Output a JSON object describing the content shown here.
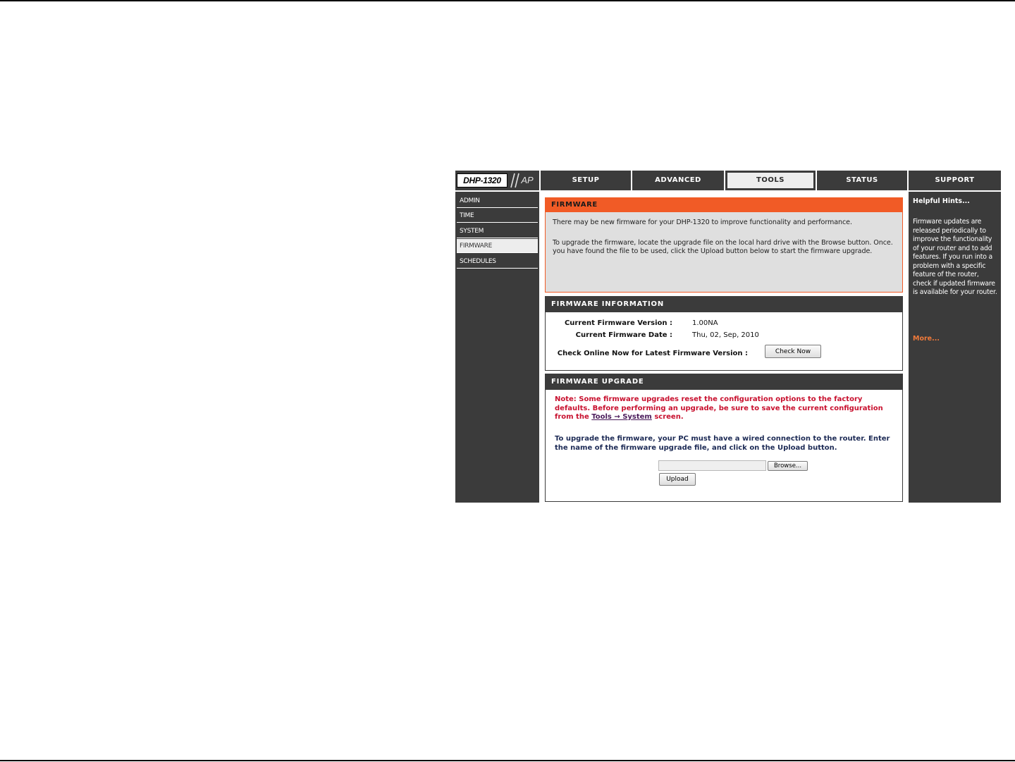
{
  "logo": {
    "model": "DHP-1320",
    "suffix": "AP"
  },
  "tabs": [
    {
      "label": "SETUP",
      "active": false
    },
    {
      "label": "ADVANCED",
      "active": false
    },
    {
      "label": "TOOLS",
      "active": true
    },
    {
      "label": "STATUS",
      "active": false
    },
    {
      "label": "SUPPORT",
      "active": false
    }
  ],
  "sidebar": {
    "items": [
      {
        "label": "ADMIN",
        "active": false
      },
      {
        "label": "TIME",
        "active": false
      },
      {
        "label": "SYSTEM",
        "active": false
      },
      {
        "label": "FIRMWARE",
        "active": true
      },
      {
        "label": "SCHEDULES",
        "active": false
      }
    ]
  },
  "firmware": {
    "title": "FIRMWARE",
    "intro_line1": "There may be new firmware for your DHP-1320 to improve functionality and performance.",
    "intro_line2": "To upgrade the firmware, locate the upgrade file on the local hard drive with the Browse button. Once. you have found the file to be used, click the Upload button below to start the firmware upgrade."
  },
  "firmware_info": {
    "title": "FIRMWARE INFORMATION",
    "version_label": "Current Firmware Version :",
    "version_value": "1.00NA",
    "date_label": "Current Firmware Date :",
    "date_value": "Thu, 02, Sep, 2010",
    "check_label": "Check Online Now for Latest Firmware Version :",
    "check_button": "Check Now"
  },
  "firmware_upgrade": {
    "title": "FIRMWARE UPGRADE",
    "note_text": "Note: Some firmware upgrades reset the configuration options to the factory defaults. Before performing an upgrade, be sure to save the current configuration from the",
    "note_link": "Tools → System",
    "note_suffix": " screen.",
    "instructions": "To upgrade the firmware, your PC must have a wired connection to the router. Enter the name of the firmware upgrade file, and click on the Upload button.",
    "file_value": "",
    "browse_button": "Browse...",
    "upload_button": "Upload"
  },
  "hints": {
    "title": "Helpful Hints...",
    "body": "Firmware updates are released periodically to improve the functionality of your router and to add features. If you run into a problem with a specific feature of the router, check if updated firmware is available for your router.",
    "more": "More..."
  },
  "colors": {
    "dark": "#3b3b3b",
    "orange": "#f15b26",
    "light_gray": "#dfdfdf",
    "note_red": "#c8102e",
    "note_blue": "#1c2a55",
    "more_orange": "#f17a3a"
  }
}
